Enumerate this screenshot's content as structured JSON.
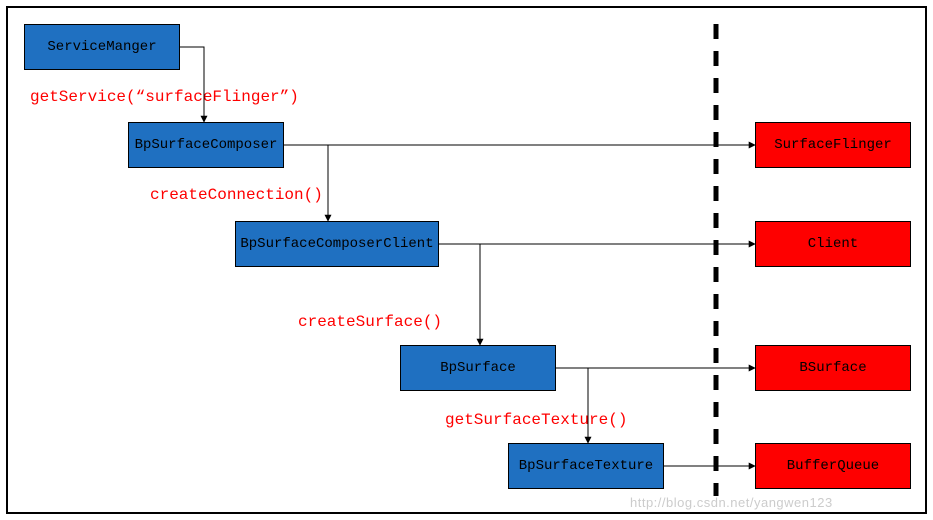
{
  "boxes": {
    "serviceManager": "ServiceManger",
    "bpSurfaceComposer": "BpSurfaceComposer",
    "bpSurfaceComposerClient": "BpSurfaceComposerClient",
    "bpSurface": "BpSurface",
    "bpSurfaceTexture": "BpSurfaceTexture",
    "surfaceFlinger": "SurfaceFlinger",
    "client": "Client",
    "bSurface": "BSurface",
    "bufferQueue": "BufferQueue"
  },
  "labels": {
    "getService": "getService(“surfaceFlinger”)",
    "createConnection": "createConnection()",
    "createSurface": "createSurface()",
    "getSurfaceTexture": "getSurfaceTexture()"
  },
  "watermark": "http://blog.csdn.net/yangwen123"
}
